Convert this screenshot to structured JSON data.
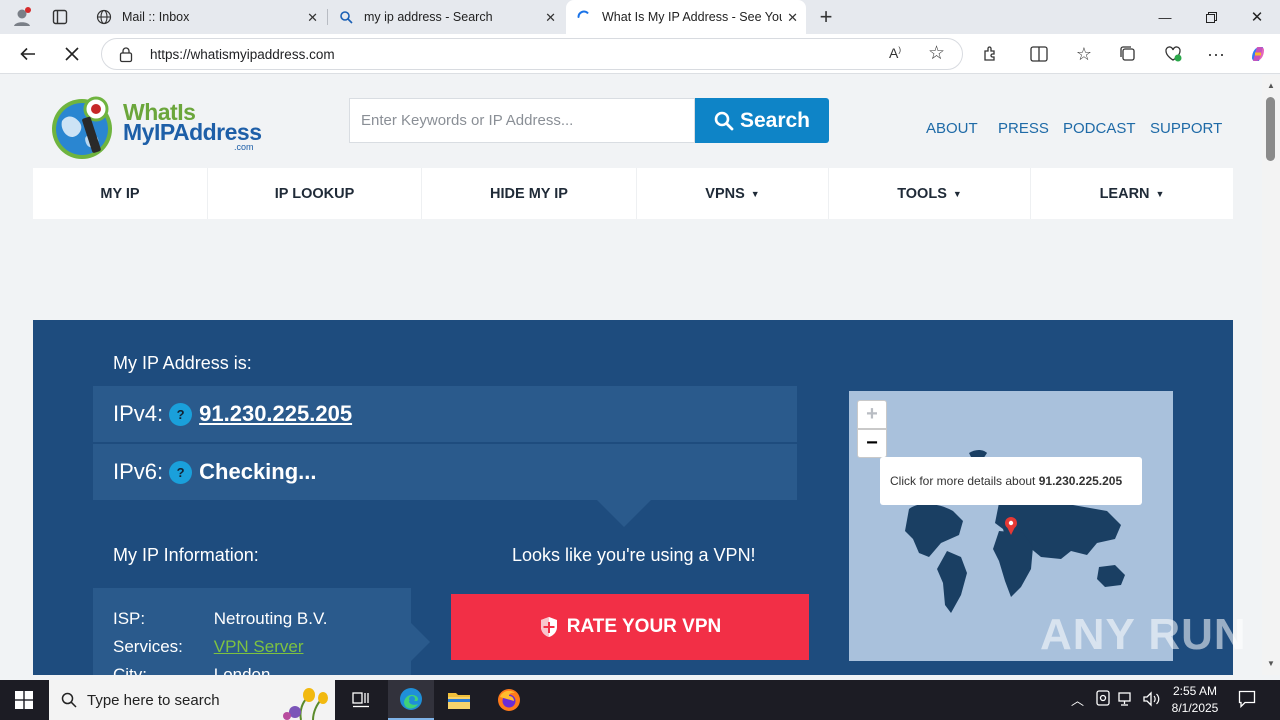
{
  "browser": {
    "tabs": [
      {
        "label": "Mail :: Inbox"
      },
      {
        "label": "my ip address - Search"
      },
      {
        "label": "What Is My IP Address - See Your"
      }
    ],
    "url": "https://whatismyipaddress.com"
  },
  "site": {
    "logo": {
      "line1": "WhatIs",
      "line2": "MyIPAddress",
      "line3": ".com"
    },
    "search": {
      "placeholder": "Enter Keywords or IP Address...",
      "button": "Search"
    },
    "toplinks": [
      "ABOUT",
      "PRESS",
      "PODCAST",
      "SUPPORT"
    ],
    "nav": [
      "MY IP",
      "IP LOOKUP",
      "HIDE MY IP",
      "VPNS",
      "TOOLS",
      "LEARN"
    ],
    "hero": {
      "ip_heading": "My IP Address is:",
      "ipv4_label": "IPv4:",
      "ipv4_value": "91.230.225.205",
      "ipv6_label": "IPv6:",
      "ipv6_value": "Checking...",
      "qmark": "?",
      "info_heading": "My IP Information:",
      "info": [
        {
          "key": "ISP:",
          "value": "Netrouting B.V."
        },
        {
          "key": "Services:",
          "value": "VPN Server"
        },
        {
          "key": "City:",
          "value": "London"
        }
      ],
      "vpn_message": "Looks like you're using a VPN!",
      "rate_button": "RATE YOUR VPN",
      "map_tooltip_prefix": "Click for more details about ",
      "map_tooltip_ip": "91.230.225.205"
    }
  },
  "taskbar": {
    "search_placeholder": "Type here to search",
    "time": "2:55 AM",
    "date": "8/1/2025"
  },
  "watermark": "ANY RUN",
  "colors": {
    "hero_bg": "#1e4c7e",
    "box_bg": "#2a5a8c",
    "accent": "#0e84c7",
    "cta": "#f22f46"
  }
}
